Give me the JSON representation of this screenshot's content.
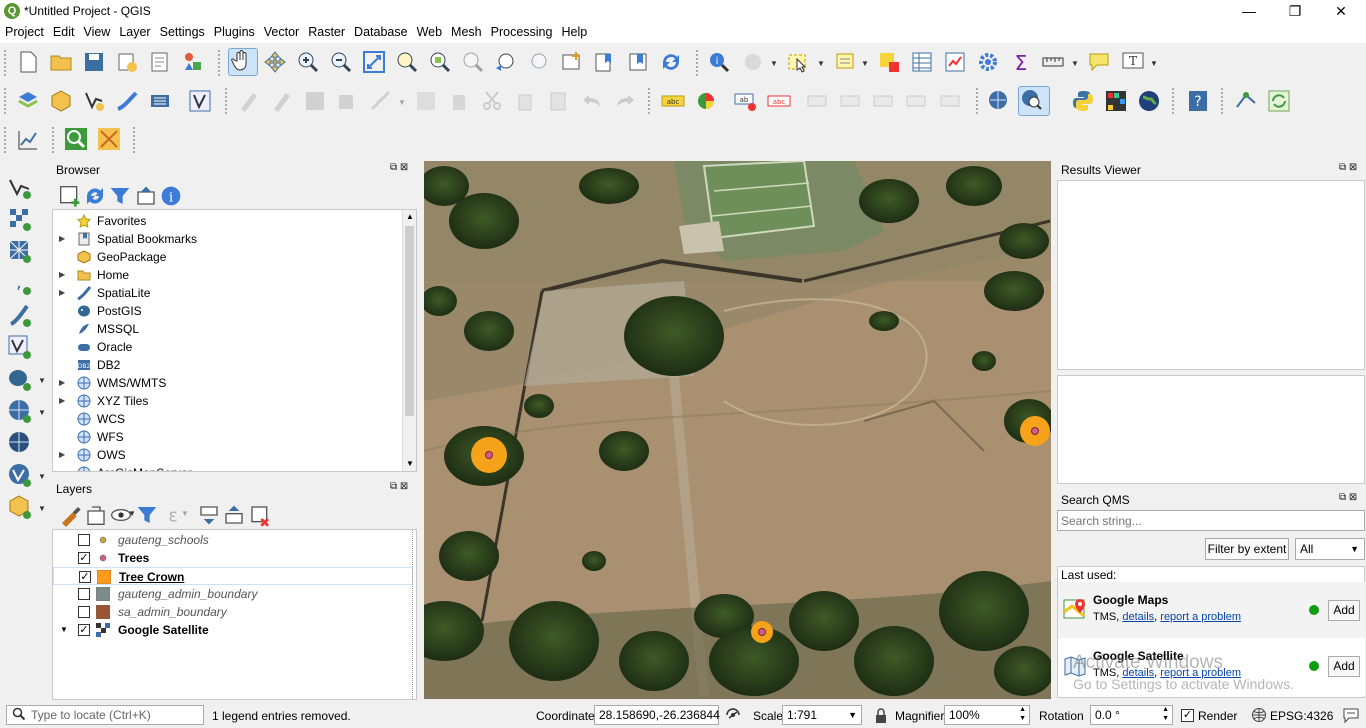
{
  "window": {
    "title": "*Untitled Project - QGIS",
    "logo": "Q",
    "minimize": "—",
    "restore": "❐",
    "close": "✕"
  },
  "menu": [
    "Project",
    "Edit",
    "View",
    "Layer",
    "Settings",
    "Plugins",
    "Vector",
    "Raster",
    "Database",
    "Web",
    "Mesh",
    "Processing",
    "Help"
  ],
  "browser": {
    "title": "Browser",
    "items": [
      {
        "label": "Favorites",
        "icon": "star-icon",
        "expandable": false
      },
      {
        "label": "Spatial Bookmarks",
        "icon": "bookmark-icon",
        "expandable": true
      },
      {
        "label": "GeoPackage",
        "icon": "geopackage-icon",
        "expandable": false
      },
      {
        "label": "Home",
        "icon": "folder-icon",
        "expandable": true
      },
      {
        "label": "SpatiaLite",
        "icon": "spatialite-icon",
        "expandable": true
      },
      {
        "label": "PostGIS",
        "icon": "postgis-elephant-icon",
        "expandable": false
      },
      {
        "label": "MSSQL",
        "icon": "mssql-icon",
        "expandable": false
      },
      {
        "label": "Oracle",
        "icon": "oracle-icon",
        "expandable": false
      },
      {
        "label": "DB2",
        "icon": "db2-icon",
        "expandable": false
      },
      {
        "label": "WMS/WMTS",
        "icon": "globe-icon",
        "expandable": true
      },
      {
        "label": "XYZ Tiles",
        "icon": "globe-icon",
        "expandable": true
      },
      {
        "label": "WCS",
        "icon": "globe-icon",
        "expandable": false
      },
      {
        "label": "WFS",
        "icon": "globe-icon",
        "expandable": false
      },
      {
        "label": "OWS",
        "icon": "globe-icon",
        "expandable": true
      },
      {
        "label": "ArcGisMapServer",
        "icon": "globe-icon",
        "expandable": false
      }
    ]
  },
  "layers": {
    "title": "Layers",
    "items": [
      {
        "label": "gauteng_schools",
        "checked": false,
        "symbol": "point",
        "color": "#c8a43c",
        "style": "italic",
        "expand": false
      },
      {
        "label": "Trees",
        "checked": true,
        "symbol": "point",
        "color": "#d85a86",
        "style": "bold",
        "expand": false
      },
      {
        "label": "Tree Crown",
        "checked": true,
        "symbol": "fill",
        "color": "#ff9a1a",
        "style": "bold-underline",
        "expand": false
      },
      {
        "label": "gauteng_admin_boundary",
        "checked": false,
        "symbol": "fill",
        "color": "#7c8a8a",
        "style": "italic",
        "expand": false
      },
      {
        "label": "sa_admin_boundary",
        "checked": false,
        "symbol": "fill",
        "color": "#9a5532",
        "style": "italic",
        "expand": false
      },
      {
        "label": "Google Satellite",
        "checked": true,
        "symbol": "raster",
        "color": "#333333",
        "style": "bold",
        "expand": true
      }
    ]
  },
  "results_viewer": {
    "title": "Results Viewer"
  },
  "qms": {
    "title": "Search QMS",
    "placeholder": "Search string...",
    "filter_button": "Filter by extent",
    "filter_value": "All",
    "last_used": "Last used:",
    "items": [
      {
        "name": "Google Maps",
        "type": "TMS",
        "details": "details",
        "report": "report a problem",
        "add": "Add"
      },
      {
        "name": "Google Satellite",
        "type": "TMS",
        "details": "details",
        "report": "report a problem",
        "add": "Add"
      }
    ],
    "watermark_line1": "Activate Windows",
    "watermark_line2": "Go to Settings to activate Windows."
  },
  "statusbar": {
    "locate_placeholder": "Type to locate (Ctrl+K)",
    "message": "1 legend entries removed.",
    "coordinate_label": "Coordinate",
    "coordinate": "28.158690,-26.236844",
    "scale_label": "Scale",
    "scale": "1:791",
    "magnifier_label": "Magnifier",
    "magnifier": "100%",
    "rotation_label": "Rotation",
    "rotation": "0.0 °",
    "render_label": "Render",
    "crs": "EPSG:4326"
  },
  "colors": {
    "accent": "#589632",
    "crown": "#f7a21b",
    "tree_point": "#d85a86",
    "link": "#0645ad"
  }
}
